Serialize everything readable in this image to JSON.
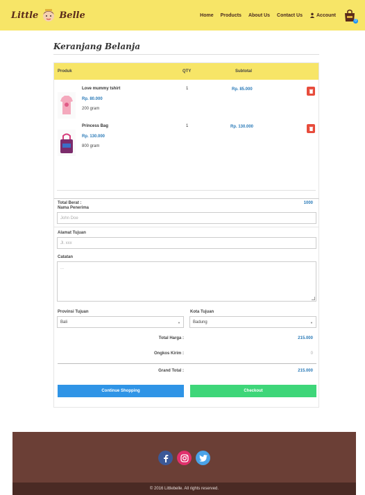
{
  "brand": {
    "name_left": "Little",
    "name_right": "Belle"
  },
  "nav": {
    "items": [
      "Home",
      "Products",
      "About Us",
      "Contact Us",
      "Account"
    ]
  },
  "cart_badge": "0",
  "page_title": "Keranjang Belanja",
  "table": {
    "headers": [
      "Produk",
      "QTY",
      "Subtotal"
    ],
    "rows": [
      {
        "name": "Love mummy tshirt",
        "price": "Rp. 80.000",
        "weight": "200 gram",
        "qty": "1",
        "subtotal": "Rp. 85.000"
      },
      {
        "name": "Princess Bag",
        "price": "Rp. 130.000",
        "weight": "800 gram",
        "qty": "1",
        "subtotal": "Rp. 130.000"
      }
    ],
    "total_label": "Total Berat :",
    "total_value": "1000"
  },
  "form": {
    "recipient_label": "Nama Penerima",
    "recipient_placeholder": "John Doe",
    "address_label": "Alamat Tujuan",
    "address_placeholder": "Jl. xxx",
    "notes_label": "Catatan",
    "notes_placeholder": "...",
    "province_label": "Provinsi Tujuan",
    "province_value": "Bali",
    "city_label": "Kota Tujuan",
    "city_value": "Badung"
  },
  "summary": {
    "total_harga_label": "Total Harga :",
    "total_harga_value": "215.000",
    "ongkos_label": "Ongkos Kirim :",
    "ongkos_value": "0",
    "grand_label": "Grand Total :",
    "grand_value": "215.000"
  },
  "buttons": {
    "continue": "Continue Shopping",
    "checkout": "Checkout"
  },
  "footer": {
    "copyright": "© 2016 Littlebelle. All rights reserved."
  },
  "colors": {
    "navbar": "#f7e567",
    "price": "#2a7ab8",
    "footer": "#6b3f36",
    "continue": "#2f94e6",
    "checkout": "#3ed679",
    "delete": "#e74c3c"
  }
}
